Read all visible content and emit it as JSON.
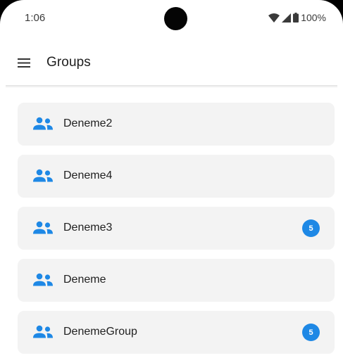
{
  "status_bar": {
    "time": "1:06",
    "battery": "100%"
  },
  "app_bar": {
    "title": "Groups"
  },
  "colors": {
    "accent": "#1e88e5",
    "card_background": "#f3f3f3"
  },
  "groups": [
    {
      "name": "Deneme2",
      "icon": "group-icon",
      "badge": ""
    },
    {
      "name": "Deneme4",
      "icon": "group-icon",
      "badge": ""
    },
    {
      "name": "Deneme3",
      "icon": "group-icon",
      "badge": "5"
    },
    {
      "name": "Deneme",
      "icon": "group-icon",
      "badge": ""
    },
    {
      "name": "DenemeGroup",
      "icon": "group-icon",
      "badge": "5"
    }
  ]
}
